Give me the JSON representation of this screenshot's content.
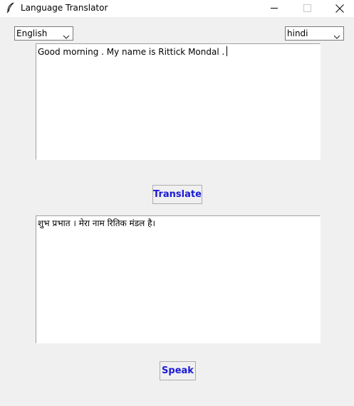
{
  "window": {
    "title": "Language Translator",
    "icons": {
      "app": "feather-icon",
      "minimize": "minimize-icon",
      "maximize": "maximize-icon",
      "close": "close-icon"
    }
  },
  "source_language": {
    "selected": "English",
    "icon": "chevron-down-icon"
  },
  "target_language": {
    "selected": "hindi",
    "icon": "chevron-down-icon"
  },
  "input_text": "Good morning . My name is Rittick Mondal .",
  "translate_button": "Translate",
  "output_text": "शुभ प्रभात । मेरा नाम रितिक मंडल है।",
  "speak_button": "Speak",
  "colors": {
    "background": "#f0f0f0",
    "button_text": "#1a1ad6",
    "text_area": "#ffffff"
  }
}
